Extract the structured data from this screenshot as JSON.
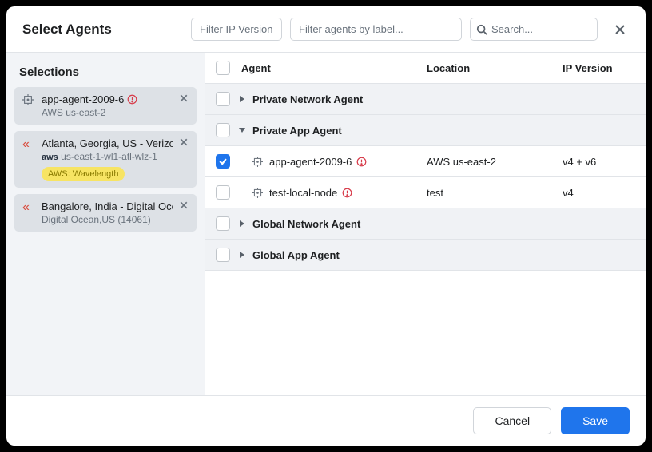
{
  "modal": {
    "title": "Select Agents",
    "filters": {
      "ip_version_placeholder": "Filter IP Version...",
      "label_placeholder": "Filter agents by label...",
      "search_placeholder": "Search..."
    }
  },
  "sidebar": {
    "title": "Selections",
    "items": [
      {
        "icon": "crosshair",
        "title": "app-agent-2009-6",
        "alert": true,
        "subtitle": "AWS us-east-2",
        "badge": null
      },
      {
        "icon": "chev-red",
        "title": "Atlanta, Georgia, US - Verizon...",
        "alert": false,
        "subtitle_prefix_aws": true,
        "subtitle": "us-east-1-wl1-atl-wlz-1",
        "badge": "AWS: Wavelength"
      },
      {
        "icon": "chev-red",
        "title": "Bangalore, India - Digital Oce...",
        "alert": false,
        "subtitle": "Digital Ocean,US (14061)",
        "badge": null
      }
    ]
  },
  "table": {
    "headers": {
      "agent": "Agent",
      "location": "Location",
      "ip_version": "IP Version"
    },
    "groups": [
      {
        "label": "Private Network Agent",
        "expanded": false,
        "rows": []
      },
      {
        "label": "Private App Agent",
        "expanded": true,
        "rows": [
          {
            "checked": true,
            "name": "app-agent-2009-6",
            "alert": true,
            "location": "AWS us-east-2",
            "ip_version": "v4 + v6"
          },
          {
            "checked": false,
            "name": "test-local-node",
            "alert": true,
            "location": "test",
            "ip_version": "v4"
          }
        ]
      },
      {
        "label": "Global Network Agent",
        "expanded": false,
        "rows": []
      },
      {
        "label": "Global App Agent",
        "expanded": false,
        "rows": []
      }
    ]
  },
  "footer": {
    "cancel": "Cancel",
    "save": "Save"
  }
}
